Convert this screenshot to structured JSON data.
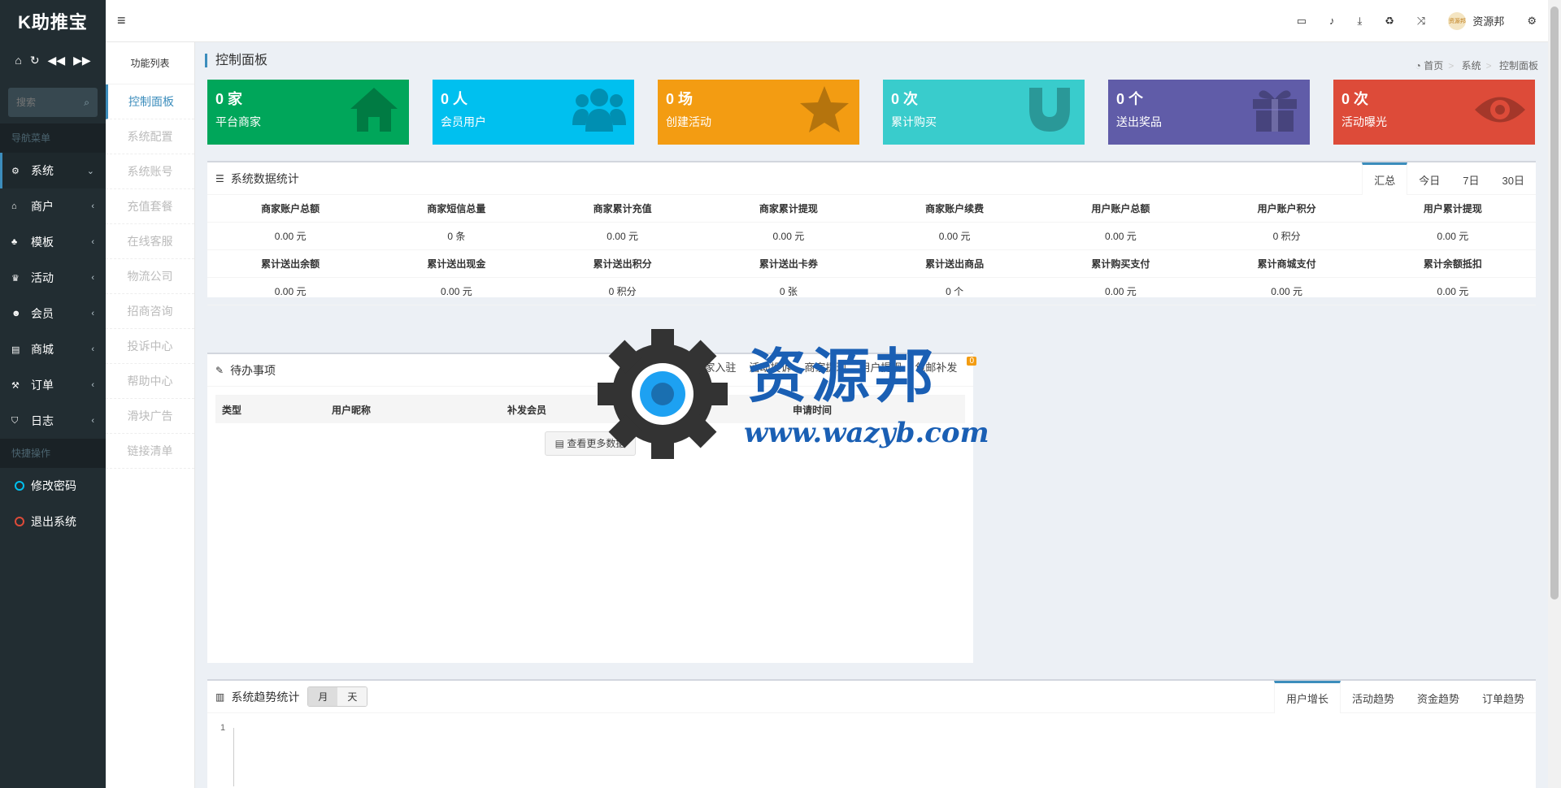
{
  "app": {
    "logo": "K助推宝"
  },
  "sidebar": {
    "search_placeholder": "搜索",
    "nav_header": "导航菜单",
    "items": [
      {
        "label": "系统",
        "icon": "gear-icon",
        "active": true
      },
      {
        "label": "商户",
        "icon": "home-icon"
      },
      {
        "label": "模板",
        "icon": "sitemap-icon"
      },
      {
        "label": "活动",
        "icon": "trophy-icon"
      },
      {
        "label": "会员",
        "icon": "users-icon"
      },
      {
        "label": "商城",
        "icon": "cart-icon"
      },
      {
        "label": "订单",
        "icon": "hammer-icon"
      },
      {
        "label": "日志",
        "icon": "shield-icon"
      }
    ],
    "quick_header": "快捷操作",
    "quick": [
      {
        "label": "修改密码",
        "color": "#00c0ef"
      },
      {
        "label": "退出系统",
        "color": "#dd4b39"
      }
    ]
  },
  "submenu": {
    "title": "功能列表",
    "items": [
      "控制面板",
      "系统配置",
      "系统账号",
      "充值套餐",
      "在线客服",
      "物流公司",
      "招商咨询",
      "投诉中心",
      "帮助中心",
      "滑块广告",
      "链接清单"
    ]
  },
  "topbar": {
    "username": "资源邦",
    "avatar_text": "资源邦"
  },
  "page": {
    "title": "控制面板",
    "breadcrumb": [
      "首页",
      "系统",
      "控制面板"
    ]
  },
  "stats": [
    {
      "num": "0 家",
      "label": "平台商家",
      "color": "#00a65a",
      "icon": "home-icon"
    },
    {
      "num": "0 人",
      "label": "会员用户",
      "color": "#00c0ef",
      "icon": "users-icon"
    },
    {
      "num": "0 场",
      "label": "创建活动",
      "color": "#f39c12",
      "icon": "star-icon"
    },
    {
      "num": "0 次",
      "label": "累计购买",
      "color": "#39cccc",
      "icon": "magnet-icon"
    },
    {
      "num": "0 个",
      "label": "送出奖品",
      "color": "#605ca8",
      "icon": "gift-icon"
    },
    {
      "num": "0 次",
      "label": "活动曝光",
      "color": "#dd4b39",
      "icon": "eye-icon"
    }
  ],
  "system_stats": {
    "title": "系统数据统计",
    "tabs": [
      "汇总",
      "今日",
      "7日",
      "30日"
    ],
    "rows": [
      [
        "商家账户总额",
        "商家短信总量",
        "商家累计充值",
        "商家累计提现",
        "商家账户续费",
        "用户账户总额",
        "用户账户积分",
        "用户累计提现"
      ],
      [
        "0.00 元",
        "0 条",
        "0.00 元",
        "0.00 元",
        "0.00 元",
        "0.00 元",
        "0 积分",
        "0.00 元"
      ],
      [
        "累计送出余额",
        "累计送出现金",
        "累计送出积分",
        "累计送出卡券",
        "累计送出商品",
        "累计购买支付",
        "累计商城支付",
        "累计余额抵扣"
      ],
      [
        "0.00 元",
        "0.00 元",
        "0 积分",
        "0 张",
        "0 个",
        "0.00 元",
        "0.00 元",
        "0.00 元"
      ]
    ]
  },
  "todo": {
    "title": "待办事项",
    "tabs": [
      "新进会员",
      "商家入驻",
      "活动投诉",
      "商家提现",
      "用户提现",
      "包邮补发"
    ],
    "badge": "0",
    "columns": [
      "类型",
      "用户昵称",
      "补发会员",
      "金额",
      "申请时间"
    ],
    "more": "查看更多数据"
  },
  "trend": {
    "title": "系统趋势统计",
    "seg": [
      "月",
      "天"
    ],
    "tabs": [
      "用户增长",
      "活动趋势",
      "资金趋势",
      "订单趋势"
    ],
    "y_tick": "1"
  },
  "watermark": {
    "text": "资源邦",
    "url": "www.wazyb.com"
  }
}
